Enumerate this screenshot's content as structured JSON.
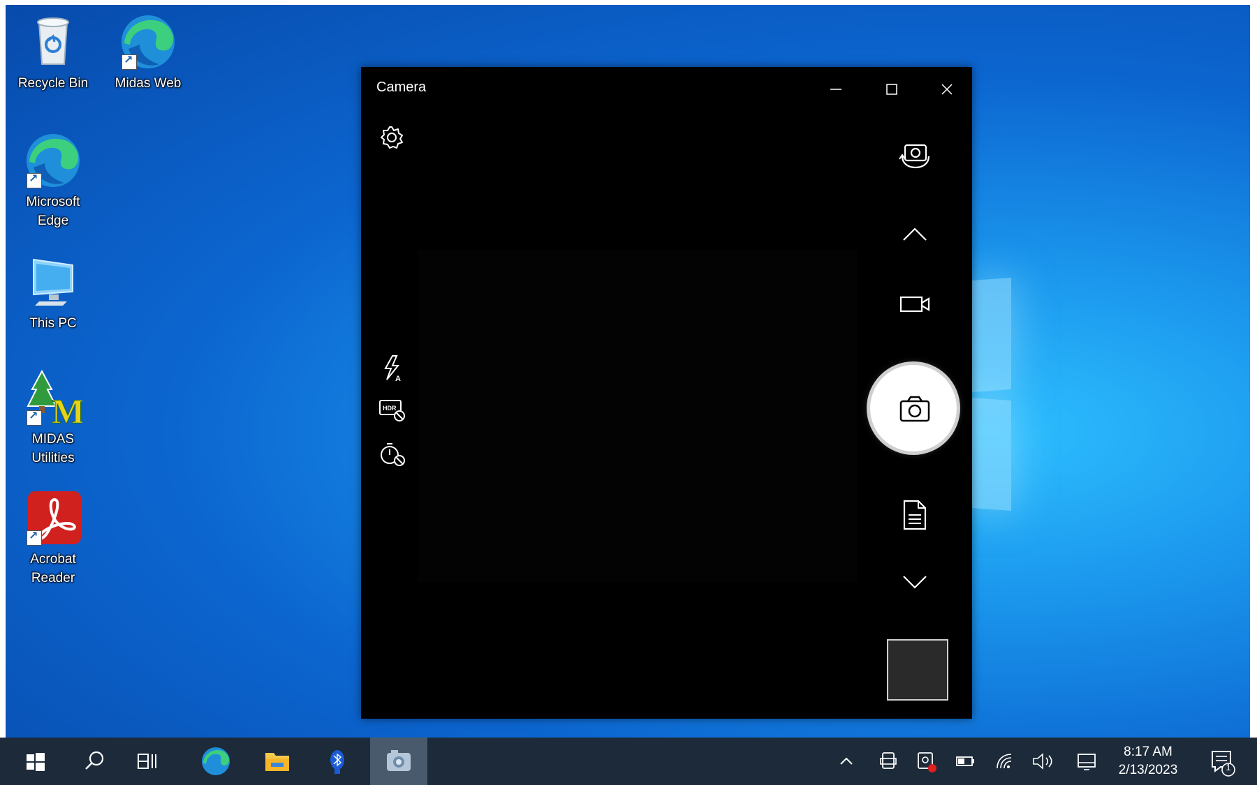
{
  "desktop": {
    "icons": [
      {
        "label": "Recycle Bin"
      },
      {
        "label": "Midas Web"
      },
      {
        "label": "Microsoft Edge"
      },
      {
        "label": "This PC"
      },
      {
        "label": "MIDAS Utilities"
      },
      {
        "label": "Acrobat Reader"
      }
    ]
  },
  "camera": {
    "title": "Camera",
    "left_controls": [
      "settings-icon",
      "flash-auto-icon",
      "hdr-off-icon",
      "timer-off-icon"
    ],
    "right_controls": [
      "switch-camera-icon",
      "chevron-up-icon",
      "video-mode-icon",
      "photo-capture-icon",
      "document-mode-icon",
      "chevron-down-icon"
    ]
  },
  "taskbar": {
    "apps": [
      "start-icon",
      "search-icon",
      "task-view-icon",
      "edge-icon",
      "file-explorer-icon",
      "bluetooth-app-icon",
      "camera-app-icon"
    ],
    "tray": [
      "show-hidden-icons",
      "tablet-icon",
      "camera-privacy-icon",
      "battery-icon",
      "wifi-icon",
      "volume-icon",
      "touch-keyboard-icon"
    ],
    "time": "8:17 AM",
    "date": "2/13/2023",
    "notification_count": "1"
  },
  "colors": {
    "taskbar": "#1c2a3a",
    "desktop_accent": "#1a95ec",
    "window_bg": "#000000"
  }
}
